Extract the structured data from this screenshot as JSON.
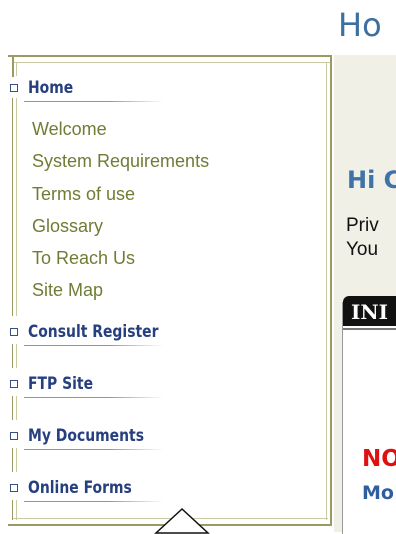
{
  "header": {
    "title": "Ho"
  },
  "nav": {
    "home": {
      "label": "Home"
    },
    "home_links": [
      {
        "label": "Welcome"
      },
      {
        "label": "System Requirements"
      },
      {
        "label": "Terms of use"
      },
      {
        "label": "Glossary"
      },
      {
        "label": "To Reach Us"
      },
      {
        "label": "Site Map"
      }
    ],
    "consult_register": {
      "label": "Consult Register"
    },
    "ftp_site": {
      "label": "FTP Site"
    },
    "my_documents": {
      "label": "My Documents"
    },
    "online_forms": {
      "label": "Online Forms"
    }
  },
  "main": {
    "greeting": "Hi C",
    "line1": "Priv",
    "line2": "You",
    "info_tab": "INI",
    "notice": "NO",
    "more": "Mo"
  },
  "colors": {
    "nav_heading": "#263f7e",
    "nav_link": "#6e7d35",
    "frame": "#9a9a63",
    "title": "#3d6fa0",
    "notice": "#e01010"
  }
}
